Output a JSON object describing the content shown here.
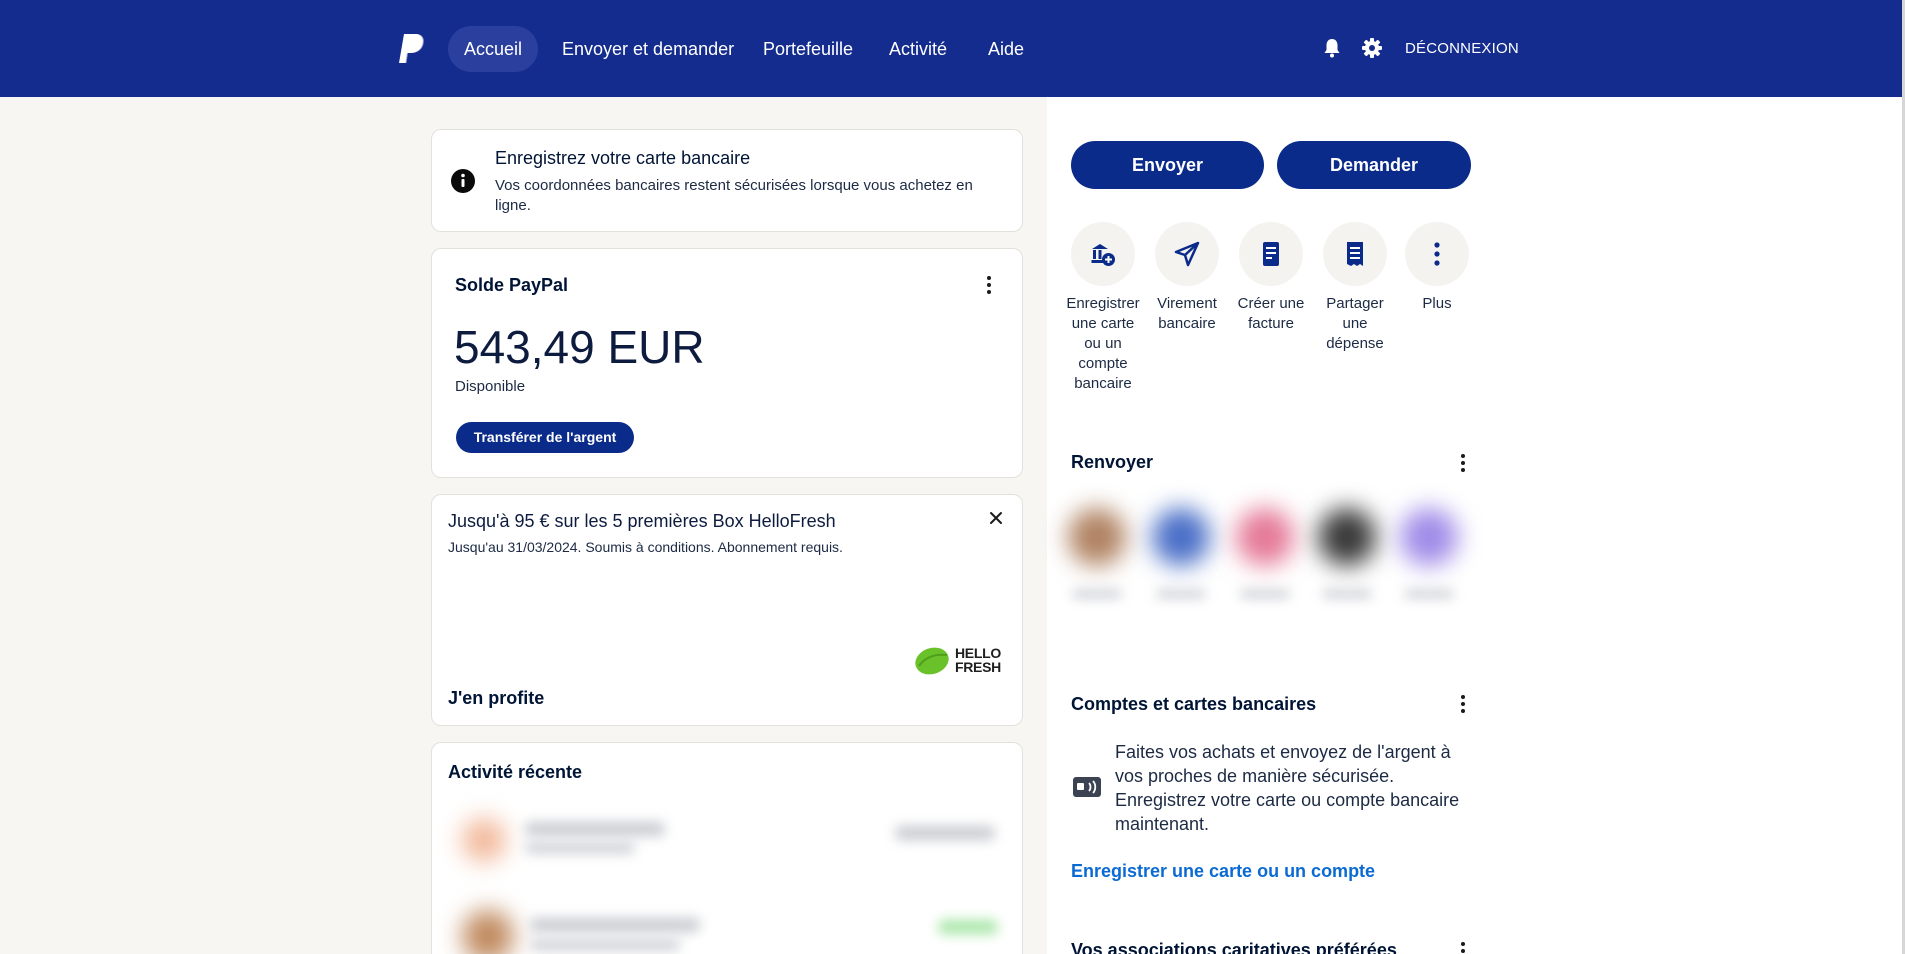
{
  "nav": {
    "items": [
      "Accueil",
      "Envoyer et demander",
      "Portefeuille",
      "Activité",
      "Aide"
    ],
    "logout_label": "DÉCONNEXION",
    "icons": [
      "paypal-logo",
      "bell-icon",
      "gear-icon"
    ]
  },
  "info_banner": {
    "title": "Enregistrez votre carte bancaire",
    "text": "Vos coordonnées bancaires restent sécurisées lorsque vous achetez en ligne.",
    "icon": "info-icon"
  },
  "balance": {
    "title": "Solde PayPal",
    "amount": "543,49 EUR",
    "status": "Disponible",
    "transfer_label": "Transférer de l'argent"
  },
  "promo": {
    "title": "Jusqu'à 95 € sur les 5 premières Box HelloFresh",
    "subtitle": "Jusqu'au 31/03/2024. Soumis à conditions. Abonnement requis.",
    "brand_line1": "HELLO",
    "brand_line2": "FRESH",
    "cta_label": "J'en profite"
  },
  "recent": {
    "title": "Activité récente"
  },
  "actions": {
    "send_label": "Envoyer",
    "request_label": "Demander"
  },
  "quick_actions": [
    {
      "label_lines": [
        "Enregistrer",
        "une carte",
        "ou un",
        "compte",
        "bancaire"
      ],
      "icon": "bank-add-icon"
    },
    {
      "label_lines": [
        "Virement",
        "bancaire"
      ],
      "icon": "send-arrow-icon"
    },
    {
      "label_lines": [
        "Créer une",
        "facture"
      ],
      "icon": "invoice-icon"
    },
    {
      "label_lines": [
        "Partager",
        "une",
        "dépense"
      ],
      "icon": "receipt-split-icon"
    },
    {
      "label_lines": [
        "Plus"
      ],
      "icon": "more-icon"
    }
  ],
  "resend": {
    "title": "Renvoyer"
  },
  "accounts": {
    "title": "Comptes et cartes bancaires",
    "text": "Faites vos achats et envoyez de l'argent à vos proches de manière sécurisée. Enregistrez votre carte ou compte bancaire maintenant.",
    "link_label": "Enregistrer une carte ou un compte"
  },
  "charity": {
    "title": "Vos associations caritatives préférées"
  },
  "colors": {
    "topbar": "#142c8e",
    "primary_button": "#0b2b8a",
    "link": "#0b6bd3",
    "page_left_bg": "#f7f6f3"
  }
}
